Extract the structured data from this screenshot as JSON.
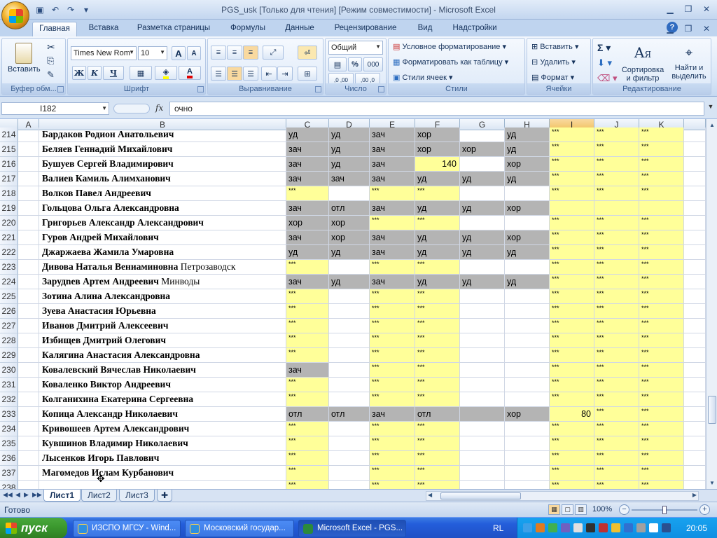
{
  "window": {
    "title": "PGS_usk  [Только для чтения]  [Режим совместимости] - Microsoft Excel"
  },
  "ribbon_tabs": [
    "Главная",
    "Вставка",
    "Разметка страницы",
    "Формулы",
    "Данные",
    "Рецензирование",
    "Вид",
    "Надстройки"
  ],
  "active_tab": "Главная",
  "clipboard": {
    "paste": "Вставить",
    "label": "Буфер обм..."
  },
  "font": {
    "name": "Times New Rom",
    "size": "10",
    "label": "Шрифт",
    "bold": "Ж",
    "italic": "К",
    "underline": "Ч",
    "grow": "A",
    "shrink": "A"
  },
  "alignment": {
    "label": "Выравнивание"
  },
  "number": {
    "format": "Общий",
    "label": "Число",
    "percent": "%",
    "thousands": "000",
    "inc": ",0 ,00",
    "dec": ",00 ,0"
  },
  "styles": {
    "conditional": "Условное форматирование",
    "table": "Форматировать как таблицу",
    "cell": "Стили ячеек",
    "label": "Стили"
  },
  "cells": {
    "insert": "Вставить",
    "delete": "Удалить",
    "format": "Формат",
    "label": "Ячейки"
  },
  "editing": {
    "sum": "Σ",
    "sort": "Сортировка и фильтр",
    "find": "Найти и выделить",
    "label": "Редактирование",
    "sort_l1": "Сортировка",
    "sort_l2": "и фильтр",
    "find_l1": "Найти и",
    "find_l2": "выделить"
  },
  "formula_bar": {
    "name_box": "I182",
    "fx": "fx",
    "value": "очно"
  },
  "columns": [
    "A",
    "B",
    "C",
    "D",
    "E",
    "F",
    "G",
    "H",
    "I",
    "J",
    "K"
  ],
  "selected_column": "I",
  "rows": [
    {
      "n": "214",
      "name": "Бардаков Родион Анатольевич",
      "extra": "",
      "c": [
        "уд",
        "уд",
        "зач",
        "хор",
        "",
        "уд",
        "***",
        "***",
        "***"
      ],
      "f": [
        "g",
        "g",
        "g",
        "g",
        "",
        "g",
        "y",
        "y",
        "y"
      ]
    },
    {
      "n": "215",
      "name": "Беляев Геннадий Михайлович",
      "extra": "",
      "c": [
        "зач",
        "уд",
        "зач",
        "хор",
        "хор",
        "уд",
        "***",
        "***",
        "***"
      ],
      "f": [
        "g",
        "g",
        "g",
        "g",
        "g",
        "g",
        "y",
        "y",
        "y"
      ]
    },
    {
      "n": "216",
      "name": "Бушуев Сергей Владимирович",
      "extra": "",
      "c": [
        "зач",
        "уд",
        "зач",
        "140",
        "",
        "хор",
        "***",
        "***",
        "***"
      ],
      "f": [
        "g",
        "g",
        "g",
        "yn",
        "",
        "g",
        "y",
        "y",
        "y"
      ]
    },
    {
      "n": "217",
      "name": "Валиев Камиль Алимханович",
      "extra": "",
      "c": [
        "зач",
        "зач",
        "зач",
        "уд",
        "уд",
        "уд",
        "***",
        "***",
        "***"
      ],
      "f": [
        "g",
        "g",
        "g",
        "g",
        "g",
        "g",
        "y",
        "y",
        "y"
      ]
    },
    {
      "n": "218",
      "name": "Волков Павел Андреевич",
      "extra": "",
      "c": [
        "***",
        "",
        "***",
        "***",
        "",
        "",
        "***",
        "***",
        "***"
      ],
      "f": [
        "y",
        "",
        "y",
        "y",
        "",
        "",
        "y",
        "y",
        "y"
      ]
    },
    {
      "n": "219",
      "name": "Гольцова Ольга Александровна",
      "extra": "",
      "c": [
        "зач",
        "отл",
        "зач",
        "уд",
        "уд",
        "хор",
        "",
        "",
        ""
      ],
      "f": [
        "g",
        "g",
        "g",
        "g",
        "g",
        "g",
        "y",
        "y",
        "y"
      ]
    },
    {
      "n": "220",
      "name": "Григорьев Александр Александрович",
      "extra": "",
      "c": [
        "хор",
        "хор",
        "***",
        "***",
        "",
        "",
        "***",
        "***",
        "***"
      ],
      "f": [
        "g",
        "g",
        "y",
        "y",
        "",
        "",
        "y",
        "y",
        "y"
      ]
    },
    {
      "n": "221",
      "name": "Гуров Андрей Михайлович",
      "extra": "",
      "c": [
        "зач",
        "хор",
        "зач",
        "уд",
        "уд",
        "хор",
        "***",
        "***",
        "***"
      ],
      "f": [
        "g",
        "g",
        "g",
        "g",
        "g",
        "g",
        "y",
        "y",
        "y"
      ]
    },
    {
      "n": "222",
      "name": "Джаржаева Жамила Умаровна",
      "extra": "",
      "c": [
        "уд",
        "уд",
        "зач",
        "уд",
        "уд",
        "уд",
        "***",
        "***",
        "***"
      ],
      "f": [
        "g",
        "g",
        "g",
        "g",
        "g",
        "g",
        "y",
        "y",
        "y"
      ]
    },
    {
      "n": "223",
      "name": "Дивова Наталья Вениаминовна",
      "extra": " Петрозаводск",
      "c": [
        "***",
        "",
        "***",
        "***",
        "",
        "",
        "***",
        "***",
        "***"
      ],
      "f": [
        "y",
        "",
        "y",
        "y",
        "",
        "",
        "y",
        "y",
        "y"
      ]
    },
    {
      "n": "224",
      "name": "Зарудnев Артем Андреевич",
      "extra": " Минводы",
      "c": [
        "зач",
        "уд",
        "зач",
        "уд",
        "уд",
        "уд",
        "***",
        "***",
        "***"
      ],
      "f": [
        "g",
        "g",
        "g",
        "g",
        "g",
        "g",
        "y",
        "y",
        "y"
      ]
    },
    {
      "n": "225",
      "name": "Зотина Алина Александровна",
      "extra": "",
      "c": [
        "***",
        "",
        "***",
        "***",
        "",
        "",
        "***",
        "***",
        "***"
      ],
      "f": [
        "y",
        "",
        "y",
        "y",
        "",
        "",
        "y",
        "y",
        "y"
      ]
    },
    {
      "n": "226",
      "name": "Зуева Анастасия Юрьевна",
      "extra": "",
      "c": [
        "***",
        "",
        "***",
        "***",
        "",
        "",
        "***",
        "***",
        "***"
      ],
      "f": [
        "y",
        "",
        "y",
        "y",
        "",
        "",
        "y",
        "y",
        "y"
      ]
    },
    {
      "n": "227",
      "name": "Иванов Дмитрий Алексеевич",
      "extra": "",
      "c": [
        "***",
        "",
        "***",
        "***",
        "",
        "",
        "***",
        "***",
        "***"
      ],
      "f": [
        "y",
        "",
        "y",
        "y",
        "",
        "",
        "y",
        "y",
        "y"
      ]
    },
    {
      "n": "228",
      "name": "Избищев Дмитрий Олегович",
      "extra": "",
      "c": [
        "***",
        "",
        "***",
        "***",
        "",
        "",
        "***",
        "***",
        "***"
      ],
      "f": [
        "y",
        "",
        "y",
        "y",
        "",
        "",
        "y",
        "y",
        "y"
      ]
    },
    {
      "n": "229",
      "name": "Калягина Анастасия Александровна",
      "extra": "",
      "c": [
        "***",
        "",
        "***",
        "***",
        "",
        "",
        "***",
        "***",
        "***"
      ],
      "f": [
        "y",
        "",
        "y",
        "y",
        "",
        "",
        "y",
        "y",
        "y"
      ]
    },
    {
      "n": "230",
      "name": "Ковалевский Вячеслав Николаевич",
      "extra": "",
      "c": [
        "зач",
        "",
        "***",
        "***",
        "",
        "",
        "***",
        "***",
        "***"
      ],
      "f": [
        "g",
        "",
        "y",
        "y",
        "",
        "",
        "y",
        "y",
        "y"
      ]
    },
    {
      "n": "231",
      "name": "Коваленко Виктор Андреевич",
      "extra": "",
      "c": [
        "***",
        "",
        "***",
        "***",
        "",
        "",
        "***",
        "***",
        "***"
      ],
      "f": [
        "y",
        "",
        "y",
        "y",
        "",
        "",
        "y",
        "y",
        "y"
      ]
    },
    {
      "n": "232",
      "name": "Колганихина Екатерина Сергеевна",
      "extra": "",
      "c": [
        "***",
        "",
        "***",
        "***",
        "",
        "",
        "***",
        "***",
        "***"
      ],
      "f": [
        "y",
        "",
        "y",
        "y",
        "",
        "",
        "y",
        "y",
        "y"
      ]
    },
    {
      "n": "233",
      "name": "Копица Александр Николаевич",
      "extra": "",
      "c": [
        "отл",
        "отл",
        "зач",
        "отл",
        "",
        "хор",
        "80",
        "***",
        "***"
      ],
      "f": [
        "g",
        "g",
        "g",
        "g",
        "g",
        "g",
        "yn",
        "y",
        "y"
      ]
    },
    {
      "n": "234",
      "name": "Кривошеев Артем Александрович",
      "extra": "",
      "c": [
        "***",
        "",
        "***",
        "***",
        "",
        "",
        "***",
        "***",
        "***"
      ],
      "f": [
        "y",
        "",
        "y",
        "y",
        "",
        "",
        "y",
        "y",
        "y"
      ]
    },
    {
      "n": "235",
      "name": "Кувшинов Владимир Николаевич",
      "extra": "",
      "c": [
        "***",
        "",
        "***",
        "***",
        "",
        "",
        "***",
        "***",
        "***"
      ],
      "f": [
        "y",
        "",
        "y",
        "y",
        "",
        "",
        "y",
        "y",
        "y"
      ]
    },
    {
      "n": "236",
      "name": "Лысенков Игорь Павлович",
      "extra": "",
      "c": [
        "***",
        "",
        "***",
        "***",
        "",
        "",
        "***",
        "***",
        "***"
      ],
      "f": [
        "y",
        "",
        "y",
        "y",
        "",
        "",
        "y",
        "y",
        "y"
      ]
    },
    {
      "n": "237",
      "name": "Магомедов Ислам Курбанович",
      "extra": "",
      "c": [
        "***",
        "",
        "***",
        "***",
        "",
        "",
        "***",
        "***",
        "***"
      ],
      "f": [
        "y",
        "",
        "y",
        "y",
        "",
        "",
        "y",
        "y",
        "y"
      ]
    },
    {
      "n": "238",
      "name": "",
      "extra": "",
      "c": [
        "***",
        "",
        "***",
        "***",
        "",
        "",
        "***",
        "***",
        "***"
      ],
      "f": [
        "y",
        "",
        "y",
        "y",
        "",
        "",
        "y",
        "y",
        "y"
      ]
    }
  ],
  "sheets": [
    "Лист1",
    "Лист2",
    "Лист3"
  ],
  "active_sheet": "Лист1",
  "status": {
    "text": "Готово",
    "zoom": "100%"
  },
  "taskbar": {
    "start": "пуск",
    "tasks": [
      "ИЗСПО МГСУ - Wind...",
      "Московский государ...",
      "Microsoft Excel - PGS..."
    ],
    "lang": "RL",
    "clock": "20:05"
  },
  "colors": {
    "yellow": "#ffff99",
    "gray": "#b4b4b4",
    "selected_header": "#f1c15f"
  }
}
